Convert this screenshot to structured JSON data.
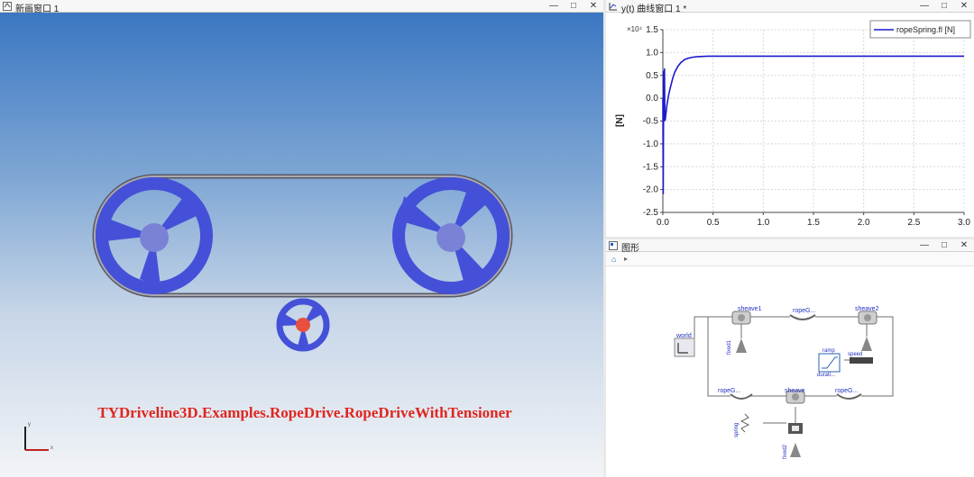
{
  "view3d": {
    "title": "新画窗口 1",
    "model_name": "TYDriveline3D.Examples.RopeDrive.RopeDriveWithTensioner",
    "axis_labels": {
      "y": "y",
      "x": "x"
    },
    "colors": {
      "pulley": "#4450d8",
      "hub": "#7a82d6",
      "tensioner_hub": "#e85040",
      "title": "#e0261e"
    }
  },
  "plot_window": {
    "title": "y(t) 曲线窗口 1 *",
    "scale_label": "×10⁴",
    "chart_data": {
      "type": "line",
      "ylabel": "[N]",
      "xlabel": "",
      "xlim": [
        0,
        3.0
      ],
      "ylim": [
        -2.5,
        1.5
      ],
      "x_ticks": [
        "0.0",
        "0.5",
        "1.0",
        "1.5",
        "2.0",
        "2.5",
        "3.0"
      ],
      "y_ticks": [
        "1.5",
        "1.0",
        "0.5",
        "0.0",
        "-0.5",
        "-1.0",
        "-1.5",
        "-2.0",
        "-2.5"
      ],
      "series": [
        {
          "name": "ropeSpring.fl [N]",
          "color": "#1a1acc",
          "x": [
            0,
            0.004,
            0.008,
            0.012,
            0.016,
            0.02,
            0.025,
            0.03,
            0.04,
            0.06,
            0.08,
            0.1,
            0.12,
            0.15,
            0.18,
            0.22,
            0.26,
            0.3,
            0.35,
            0.4,
            0.45,
            0.5,
            0.6,
            1.0,
            2.0,
            3.0
          ],
          "values": [
            0,
            -2.1,
            0.6,
            -0.1,
            0.65,
            -0.5,
            -0.45,
            -0.35,
            -0.15,
            0.1,
            0.28,
            0.45,
            0.58,
            0.7,
            0.78,
            0.85,
            0.88,
            0.9,
            0.91,
            0.915,
            0.92,
            0.92,
            0.92,
            0.92,
            0.92,
            0.92
          ]
        }
      ]
    }
  },
  "diagram_window": {
    "title": "图形",
    "labels": {
      "world": "world",
      "sheave1": "sheave1",
      "ropeG1": "ropeG...",
      "sheave2": "sheave2",
      "fixed1": "fixed1",
      "ramp": "ramp",
      "duration": "durati...",
      "speed": "speed",
      "ropeG2": "ropeG...",
      "sheave": "sheave",
      "ropeG3": "ropeG...",
      "spring": "spring",
      "fixed2": "fixed2"
    }
  }
}
